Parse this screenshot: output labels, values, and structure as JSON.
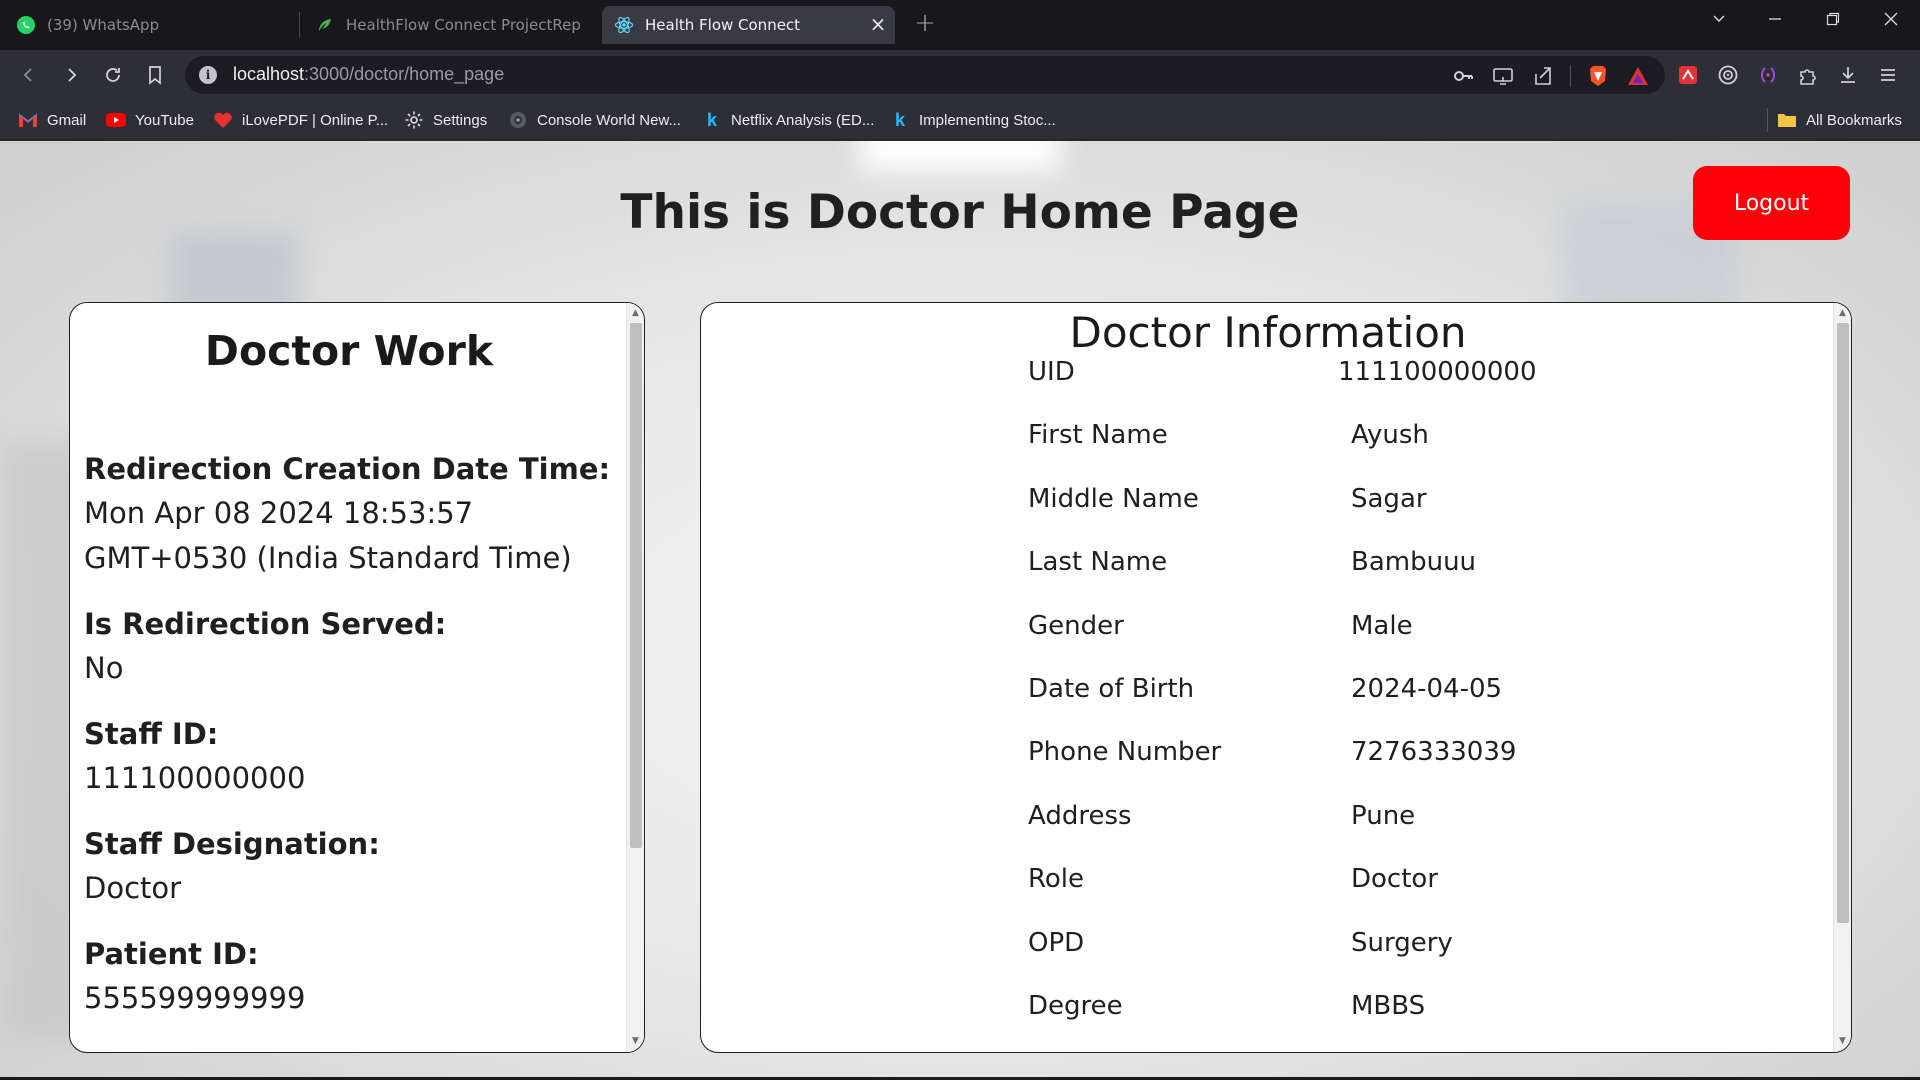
{
  "browser": {
    "tabs": [
      {
        "title": "(39) WhatsApp",
        "icon": "whatsapp-icon",
        "active": false
      },
      {
        "title": "HealthFlow Connect ProjectReport -",
        "icon": "overleaf-icon",
        "active": false
      },
      {
        "title": "Health Flow Connect",
        "icon": "react-icon",
        "active": true
      }
    ],
    "url": {
      "host": "localhost",
      "path": ":3000/doctor/home_page"
    },
    "bookmarks": [
      {
        "label": "Gmail",
        "icon": "gmail-icon"
      },
      {
        "label": "YouTube",
        "icon": "youtube-icon"
      },
      {
        "label": "iLovePDF | Online P...",
        "icon": "ilovepdf-icon"
      },
      {
        "label": "Settings",
        "icon": "gear-icon"
      },
      {
        "label": "Console World New...",
        "icon": "console-world-icon"
      },
      {
        "label": "Netflix Analysis (ED...",
        "icon": "kaggle-icon"
      },
      {
        "label": "Implementing Stoc...",
        "icon": "kaggle-icon"
      }
    ],
    "all_bookmarks": "All Bookmarks"
  },
  "page": {
    "title": "This is Doctor Home Page",
    "logout_label": "Logout"
  },
  "doctor_work": {
    "heading": "Doctor Work",
    "items": [
      {
        "label": "Redirection Creation Date Time:",
        "value": "Mon Apr 08 2024 18:53:57 GMT+0530 (India Standard Time)"
      },
      {
        "label": "Is Redirection Served:",
        "value": "No"
      },
      {
        "label": "Staff ID:",
        "value": "111100000000"
      },
      {
        "label": "Staff Designation:",
        "value": "Doctor"
      },
      {
        "label": "Patient ID:",
        "value": "555599999999"
      }
    ]
  },
  "doctor_info": {
    "heading": "Doctor Information",
    "rows": [
      {
        "label": "UID",
        "value": "111100000000"
      },
      {
        "label": "First Name",
        "value": "Ayush"
      },
      {
        "label": "Middle Name",
        "value": "Sagar"
      },
      {
        "label": "Last Name",
        "value": "Bambuuu"
      },
      {
        "label": "Gender",
        "value": "Male"
      },
      {
        "label": "Date of Birth",
        "value": "2024-04-05"
      },
      {
        "label": "Phone Number",
        "value": "7276333039"
      },
      {
        "label": "Address",
        "value": "Pune"
      },
      {
        "label": "Role",
        "value": "Doctor"
      },
      {
        "label": "OPD",
        "value": "Surgery"
      },
      {
        "label": "Degree",
        "value": "MBBS"
      }
    ]
  },
  "colors": {
    "logout_bg": "#ff0008",
    "chrome_dark": "#17171c",
    "toolbar": "#2e2e36"
  }
}
